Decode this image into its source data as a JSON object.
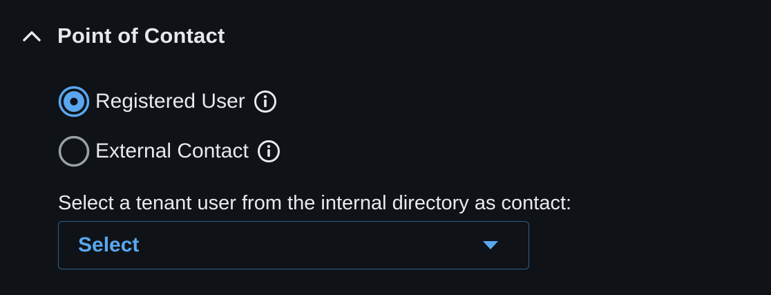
{
  "section": {
    "title": "Point of Contact",
    "expanded": true,
    "chevron_icon": "chevron-up-icon"
  },
  "contact_type": {
    "options": [
      {
        "label": "Registered User",
        "selected": true,
        "info_icon": "info-icon"
      },
      {
        "label": "External Contact",
        "selected": false,
        "info_icon": "info-icon"
      }
    ]
  },
  "tenant_user": {
    "helper_text": "Select a tenant user from the internal directory as contact:",
    "select_value": "Select",
    "caret_icon": "caret-down-icon"
  },
  "colors": {
    "background": "#0f1317",
    "text": "#e8eaed",
    "accent": "#5aa7f0",
    "radio_unselected": "#9aa0a6",
    "select_border": "#2d5f8f"
  }
}
